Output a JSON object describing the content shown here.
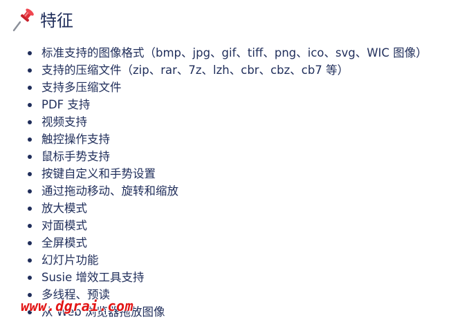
{
  "heading": {
    "icon": "pushpin-icon",
    "title": "特征"
  },
  "features": [
    "标准支持的图像格式（bmp、jpg、gif、tiff、png、ico、svg、WIC 图像）",
    "支持的压缩文件（zip、rar、7z、lzh、cbr、cbz、cb7 等）",
    "支持多压缩文件",
    "PDF 支持",
    "视频支持",
    "触控操作支持",
    "鼠标手势支持",
    "按键自定义和手势设置",
    "通过拖动移动、旋转和缩放",
    "放大模式",
    "对面模式",
    "全屏模式",
    "幻灯片功能",
    "Susie 增效工具支持",
    "多线程、预读",
    "从 Web 浏览器拖放图像"
  ],
  "watermark": {
    "text": "www.dgrai.com",
    "color": "#e21414"
  },
  "colors": {
    "text": "#1f2d5a",
    "pin": "#e0303a"
  }
}
